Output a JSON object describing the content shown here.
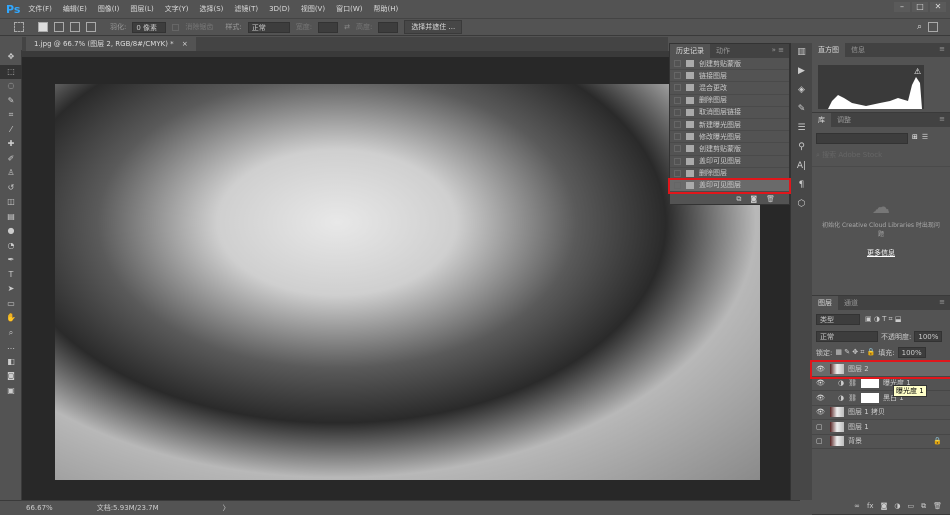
{
  "app": {
    "logo": "Ps"
  },
  "menu": [
    "文件(F)",
    "编辑(E)",
    "图像(I)",
    "图层(L)",
    "文字(Y)",
    "选择(S)",
    "滤镜(T)",
    "3D(D)",
    "视图(V)",
    "窗口(W)",
    "帮助(H)"
  ],
  "window_buttons": [
    "–",
    "□",
    "✕"
  ],
  "options": {
    "feather_label": "羽化:",
    "feather_value": "0 像素",
    "antialias_label": "消除锯齿",
    "style_label": "样式:",
    "style_value": "正常",
    "width_label": "宽度:",
    "height_label": "高度:",
    "select_mask_button": "选择并遮住 ..."
  },
  "document_tab": {
    "title": "1.jpg @ 66.7% (图层 2, RGB/8#/CMYK) *",
    "close": "×"
  },
  "status": {
    "zoom": "66.67%",
    "doc_size": "文档:5.93M/23.7M",
    "arrow": "〉"
  },
  "history": {
    "tabs": [
      "历史记录",
      "动作"
    ],
    "items": [
      "创建剪贴蒙版",
      "链接图层",
      "混合更改",
      "删除图层",
      "取消图层链接",
      "新建曝光图层",
      "修改曝光图层",
      "创建剪贴蒙版",
      "盖印可见图层",
      "删除图层",
      "盖印可见图层"
    ],
    "selected": 10
  },
  "histogram": {
    "tabs": [
      "直方图",
      "信息"
    ]
  },
  "library": {
    "tabs": [
      "库",
      "调整"
    ],
    "search_placeholder": "搜索 Adobe Stock",
    "message": "初始化 Creative Cloud Libraries 时出现问题",
    "more_info": "更多信息"
  },
  "layers": {
    "tabs": [
      "图层",
      "通道"
    ],
    "filter": "类型",
    "blend_mode": "正常",
    "opacity_label": "不透明度:",
    "opacity": "100%",
    "lock_label": "锁定:",
    "fill_label": "填充:",
    "fill": "100%",
    "items": [
      {
        "name": "图层 2",
        "visible": true,
        "selected": true,
        "type": "pixel"
      },
      {
        "name": "曝光度 1",
        "visible": true,
        "type": "adjustment"
      },
      {
        "name": "黑白 1",
        "visible": true,
        "type": "adjustment"
      },
      {
        "name": "图层 1 拷贝",
        "visible": true,
        "type": "pixel"
      },
      {
        "name": "图层 1",
        "visible": false,
        "type": "pixel"
      },
      {
        "name": "背景",
        "visible": false,
        "type": "pixel",
        "locked": true
      }
    ],
    "tooltip": "曝光度 1"
  },
  "colors": {
    "highlight": "#e0161b",
    "ps_blue": "#31a8ff"
  }
}
